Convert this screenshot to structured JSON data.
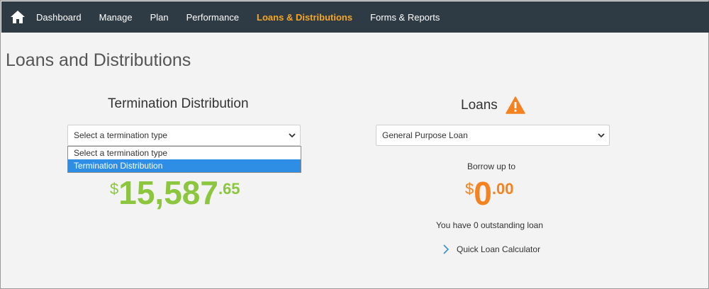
{
  "nav": {
    "home_icon": "home-icon",
    "items": [
      "Dashboard",
      "Manage",
      "Plan",
      "Performance",
      "Loans & Distributions",
      "Forms & Reports"
    ],
    "active_index": 4,
    "active_color": "#f5a623",
    "bar_color": "#2f3b44"
  },
  "page": {
    "title": "Loans and Distributions"
  },
  "termination": {
    "heading": "Termination Distribution",
    "select_value": "Select a termination type",
    "dropdown_options": [
      "Select a termination type",
      "Termination Distribution"
    ],
    "highlighted_option_index": 1,
    "balance": {
      "currency": "$",
      "whole": "15,587",
      "cents": ".65",
      "color": "#8cc63f"
    }
  },
  "loans": {
    "heading": "Loans",
    "warning_icon": "warning-icon",
    "select_value": "General Purpose Loan",
    "borrow_label": "Borrow up to",
    "amount": {
      "currency": "$",
      "whole": "0",
      "cents": ".00",
      "color": "#f58220"
    },
    "outstanding_text": "You have 0 outstanding loan",
    "calculator_link": "Quick Loan Calculator"
  }
}
